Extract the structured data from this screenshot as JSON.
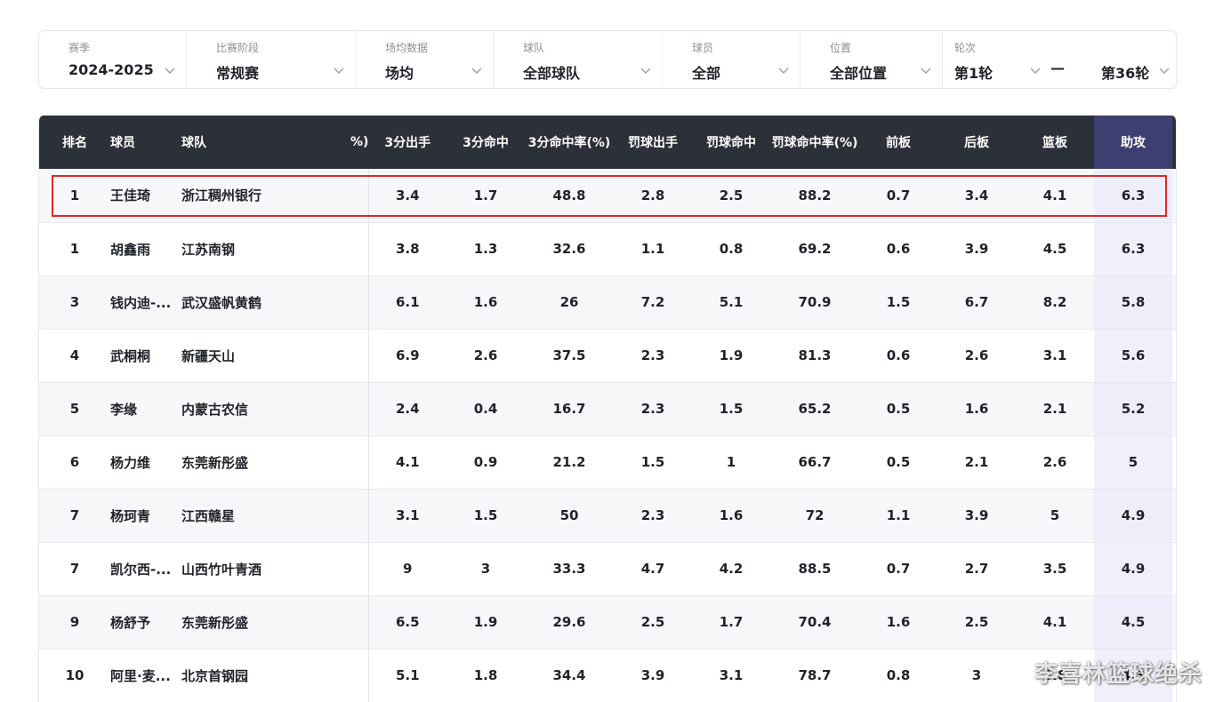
{
  "filters": {
    "season": {
      "label": "赛季",
      "value": "2024-2025"
    },
    "stage": {
      "label": "比赛阶段",
      "value": "常规赛"
    },
    "stat_type": {
      "label": "场均数据",
      "value": "场均"
    },
    "team": {
      "label": "球队",
      "value": "全部球队"
    },
    "player": {
      "label": "球员",
      "value": "全部"
    },
    "position": {
      "label": "位置",
      "value": "全部位置"
    },
    "round": {
      "label": "轮次",
      "from": "第1轮",
      "dash": "—",
      "to": "第36轮"
    }
  },
  "table": {
    "headers": {
      "rank": "排名",
      "player": "球员",
      "team": "球队",
      "clipped": "%)",
      "three_att": "3分出手",
      "three_made": "3分命中",
      "three_pct": "3分命中率(%)",
      "ft_att": "罚球出手",
      "ft_made": "罚球命中",
      "ft_pct": "罚球命中率(%)",
      "oreb": "前板",
      "dreb": "后板",
      "reb": "篮板",
      "ast": "助攻"
    },
    "rows": [
      {
        "rank": "1",
        "player": "王佳琦",
        "team": "浙江稠州银行",
        "three_att": "3.4",
        "three_made": "1.7",
        "three_pct": "48.8",
        "ft_att": "2.8",
        "ft_made": "2.5",
        "ft_pct": "88.2",
        "oreb": "0.7",
        "dreb": "3.4",
        "reb": "4.1",
        "ast": "6.3"
      },
      {
        "rank": "1",
        "player": "胡鑫雨",
        "team": "江苏南钢",
        "three_att": "3.8",
        "three_made": "1.3",
        "three_pct": "32.6",
        "ft_att": "1.1",
        "ft_made": "0.8",
        "ft_pct": "69.2",
        "oreb": "0.6",
        "dreb": "3.9",
        "reb": "4.5",
        "ast": "6.3"
      },
      {
        "rank": "3",
        "player": "钱内迪-...",
        "team": "武汉盛帆黄鹤",
        "three_att": "6.1",
        "three_made": "1.6",
        "three_pct": "26",
        "ft_att": "7.2",
        "ft_made": "5.1",
        "ft_pct": "70.9",
        "oreb": "1.5",
        "dreb": "6.7",
        "reb": "8.2",
        "ast": "5.8"
      },
      {
        "rank": "4",
        "player": "武桐桐",
        "team": "新疆天山",
        "three_att": "6.9",
        "three_made": "2.6",
        "three_pct": "37.5",
        "ft_att": "2.3",
        "ft_made": "1.9",
        "ft_pct": "81.3",
        "oreb": "0.6",
        "dreb": "2.6",
        "reb": "3.1",
        "ast": "5.6"
      },
      {
        "rank": "5",
        "player": "李缘",
        "team": "内蒙古农信",
        "three_att": "2.4",
        "three_made": "0.4",
        "three_pct": "16.7",
        "ft_att": "2.3",
        "ft_made": "1.5",
        "ft_pct": "65.2",
        "oreb": "0.5",
        "dreb": "1.6",
        "reb": "2.1",
        "ast": "5.2"
      },
      {
        "rank": "6",
        "player": "杨力维",
        "team": "东莞新彤盛",
        "three_att": "4.1",
        "three_made": "0.9",
        "three_pct": "21.2",
        "ft_att": "1.5",
        "ft_made": "1",
        "ft_pct": "66.7",
        "oreb": "0.5",
        "dreb": "2.1",
        "reb": "2.6",
        "ast": "5"
      },
      {
        "rank": "7",
        "player": "杨珂青",
        "team": "江西赣星",
        "three_att": "3.1",
        "three_made": "1.5",
        "three_pct": "50",
        "ft_att": "2.3",
        "ft_made": "1.6",
        "ft_pct": "72",
        "oreb": "1.1",
        "dreb": "3.9",
        "reb": "5",
        "ast": "4.9"
      },
      {
        "rank": "7",
        "player": "凯尔西-...",
        "team": "山西竹叶青酒",
        "three_att": "9",
        "three_made": "3",
        "three_pct": "33.3",
        "ft_att": "4.7",
        "ft_made": "4.2",
        "ft_pct": "88.5",
        "oreb": "0.7",
        "dreb": "2.7",
        "reb": "3.5",
        "ast": "4.9"
      },
      {
        "rank": "9",
        "player": "杨舒予",
        "team": "东莞新彤盛",
        "three_att": "6.5",
        "three_made": "1.9",
        "three_pct": "29.6",
        "ft_att": "2.5",
        "ft_made": "1.7",
        "ft_pct": "70.4",
        "oreb": "1.6",
        "dreb": "2.5",
        "reb": "4.1",
        "ast": "4.5"
      },
      {
        "rank": "10",
        "player": "阿里·麦...",
        "team": "北京首钢园",
        "three_att": "5.1",
        "three_made": "1.8",
        "three_pct": "34.4",
        "ft_att": "3.9",
        "ft_made": "3.1",
        "ft_pct": "78.7",
        "oreb": "0.8",
        "dreb": "3",
        "reb": "3.8",
        "ast": "4.3"
      }
    ]
  },
  "watermark": "李喜林篮球绝杀"
}
